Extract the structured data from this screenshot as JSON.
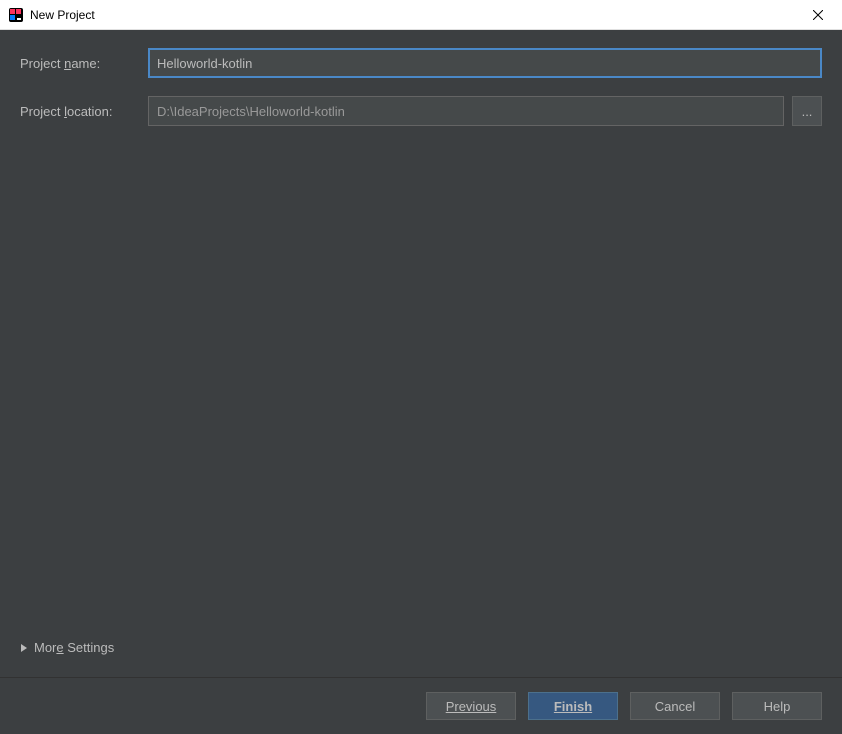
{
  "titlebar": {
    "title": "New Project"
  },
  "form": {
    "project_name": {
      "label_pre": "Project ",
      "label_mn": "n",
      "label_post": "ame:",
      "value": "Helloworld-kotlin"
    },
    "project_location": {
      "label_pre": "Project ",
      "label_mn": "l",
      "label_post": "ocation:",
      "value": "D:\\IdeaProjects\\Helloworld-kotlin",
      "browse_label": "..."
    }
  },
  "more_settings": {
    "label_pre": "Mor",
    "label_mn": "e",
    "label_post": " Settings"
  },
  "buttons": {
    "previous": "Previous",
    "finish": "Finish",
    "cancel": "Cancel",
    "help": "Help"
  }
}
